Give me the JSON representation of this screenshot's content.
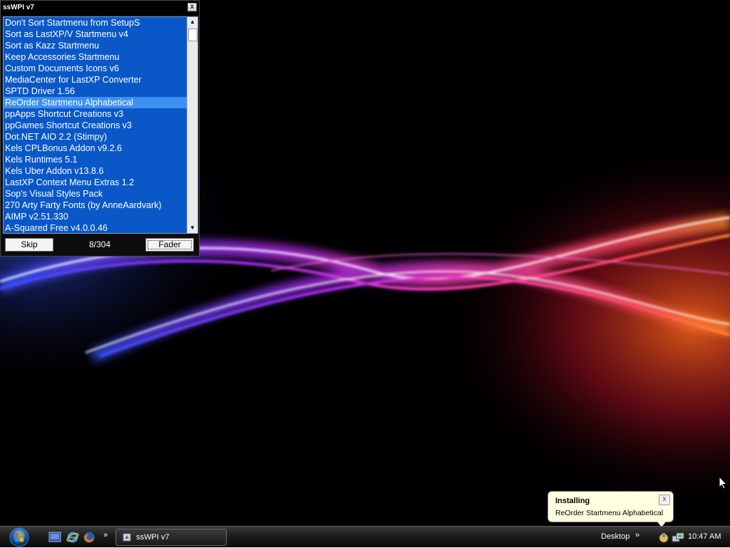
{
  "window": {
    "title": "ssWPI v7",
    "close_glyph": "x",
    "list_items": [
      "Don't Sort Startmenu from SetupS",
      "Sort as LastXP/V Startmenu v4",
      "Sort as Kazz Startmenu",
      "Keep Accessories Startmenu",
      "Custom Documents Icons v6",
      "MediaCenter for LastXP Converter",
      "SPTD Driver 1.56",
      "ReOrder Startmenu Alphabetical",
      "ppApps Shortcut Creations v3",
      "ppGames Shortcut Creations v3",
      "Dot.NET AIO 2.2 (Stimpy)",
      "Kels CPLBonus Addon v9.2.6",
      "Kels Runtimes 5.1",
      "Kels Uber Addon v13.8.6",
      "LastXP Context Menu Extras 1.2",
      "Sop's Visual Styles Pack",
      "270 Arty Farty Fonts (by AnneAardvark)",
      "AIMP v2.51.330",
      "A-Squared Free v4.0.0.46"
    ],
    "selected_index": 7,
    "skip_label": "Skip",
    "progress": "8/304",
    "fader_label": "Fader",
    "scroll_up_icon": "scroll-up-arrow-icon",
    "scroll_down_icon": "scroll-down-arrow-icon"
  },
  "balloon": {
    "title": "Installing",
    "text": "ReOrder Startmenu Alphabetical",
    "close_glyph": "x"
  },
  "taskbar": {
    "start_icon": "windows-start-orb-icon",
    "quick_launch": [
      "show-desktop-icon",
      "internet-explorer-icon",
      "firefox-icon"
    ],
    "chevron": "»",
    "task_label": "ssWPI v7",
    "desktop_label": "Desktop",
    "desktop_chevron": "»",
    "tray_icons": [
      "installer-tray-icon",
      "network-tray-icon"
    ],
    "clock": "10:47 AM"
  },
  "colors": {
    "list_background": "#0a58c8",
    "list_selected": "#3d8ff0",
    "balloon_background": "#ffffe1"
  }
}
